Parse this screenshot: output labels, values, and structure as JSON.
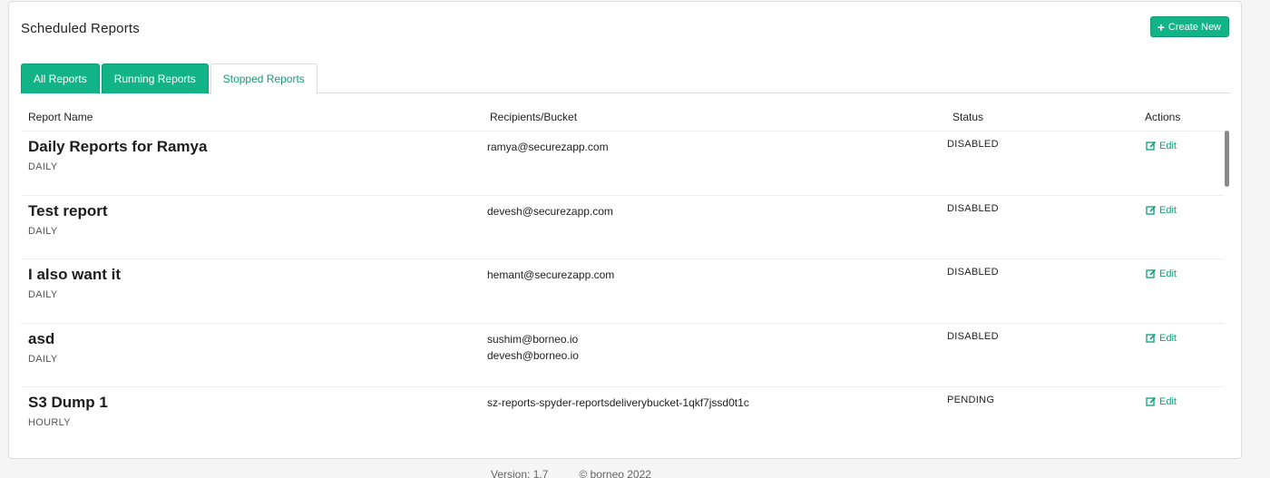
{
  "header": {
    "title": "Scheduled Reports",
    "create_label": "Create New"
  },
  "tabs": [
    {
      "label": "All Reports",
      "active": false
    },
    {
      "label": "Running Reports",
      "active": false
    },
    {
      "label": "Stopped Reports",
      "active": true
    }
  ],
  "table": {
    "columns": {
      "name": "Report Name",
      "recipients": "Recipients/Bucket",
      "status": "Status",
      "actions": "Actions"
    },
    "edit_label": "Edit",
    "rows": [
      {
        "name": "Daily Reports for Ramya",
        "frequency": "DAILY",
        "recipients": [
          "ramya@securezapp.com"
        ],
        "status": "DISABLED"
      },
      {
        "name": "Test report",
        "frequency": "DAILY",
        "recipients": [
          "devesh@securezapp.com"
        ],
        "status": "DISABLED"
      },
      {
        "name": "I also want it",
        "frequency": "DAILY",
        "recipients": [
          "hemant@securezapp.com"
        ],
        "status": "DISABLED"
      },
      {
        "name": "asd",
        "frequency": "DAILY",
        "recipients": [
          "sushim@borneo.io",
          "devesh@borneo.io"
        ],
        "status": "DISABLED"
      },
      {
        "name": "S3 Dump 1",
        "frequency": "HOURLY",
        "recipients": [
          "sz-reports-spyder-reportsdeliverybucket-1qkf7jssd0t1c"
        ],
        "status": "PENDING"
      }
    ]
  },
  "footer": {
    "version": "Version: 1.7",
    "copyright": "© borneo 2022"
  },
  "colors": {
    "accent": "#12b386",
    "accent_text": "#129e78"
  },
  "icons": {
    "create": "plus-icon",
    "edit": "edit-icon"
  }
}
